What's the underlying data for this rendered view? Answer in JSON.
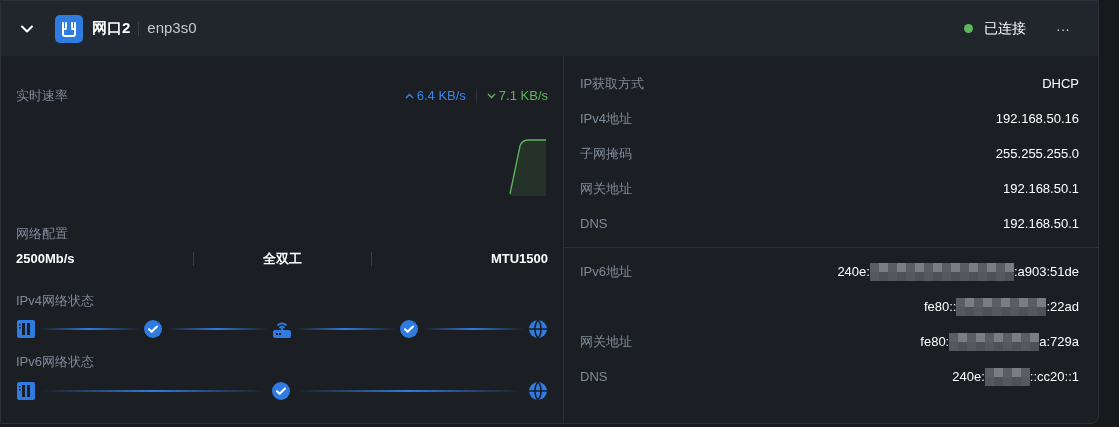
{
  "header": {
    "expanded": true,
    "title": "网口2",
    "device": "enp3s0",
    "status": {
      "label": "已连接",
      "color": "#5cb85c"
    },
    "more": "···"
  },
  "speed": {
    "label": "实时速率",
    "upload": "6.4 KB/s",
    "download": "7.1 KB/s"
  },
  "config": {
    "label": "网络配置",
    "values": [
      "2500Mb/s",
      "全双工",
      "MTU1500"
    ]
  },
  "ipv4_status": {
    "label": "IPv4网络状态",
    "nodes": [
      {
        "kind": "host"
      },
      {
        "kind": "check"
      },
      {
        "kind": "router"
      },
      {
        "kind": "check"
      },
      {
        "kind": "globe"
      }
    ]
  },
  "ipv6_status": {
    "label": "IPv6网络状态",
    "nodes": [
      {
        "kind": "host"
      },
      {
        "kind": "check"
      },
      {
        "kind": "globe"
      }
    ]
  },
  "ipv4_info": [
    {
      "label": "IP获取方式",
      "value": "DHCP"
    },
    {
      "label": "IPv4地址",
      "value": "192.168.50.16"
    },
    {
      "label": "子网掩码",
      "value": "255.255.255.0"
    },
    {
      "label": "网关地址",
      "value": "192.168.50.1"
    },
    {
      "label": "DNS",
      "value": "192.168.50.1"
    }
  ],
  "ipv6_info": [
    {
      "label": "IPv6地址",
      "prefix": "240e:",
      "suffix": ":a903:51de",
      "redacted": true
    },
    {
      "prefix": "fe80::",
      "suffix": ":22ad",
      "redacted": true
    },
    {
      "label": "网关地址",
      "prefix": "fe80:",
      "suffix": "a:729a",
      "redacted": true
    },
    {
      "label": "DNS",
      "prefix": "240e:",
      "suffix": "::cc20::1",
      "redacted": true
    }
  ]
}
